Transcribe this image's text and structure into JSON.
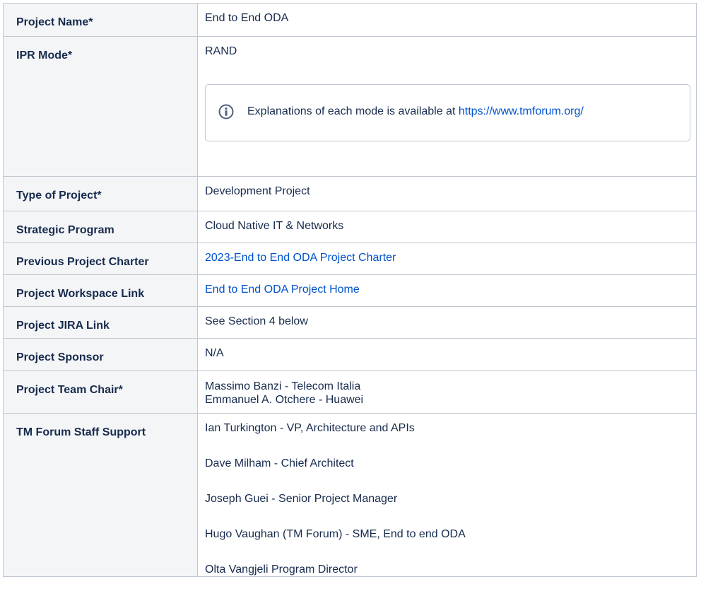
{
  "rows": {
    "project_name": {
      "label": "Project Name*",
      "value": "End to End ODA"
    },
    "ipr_mode": {
      "label": "IPR Mode*",
      "value": "RAND",
      "info": {
        "icon": "info-icon",
        "text": "Explanations of each mode is available at ",
        "link": "https://www.tmforum.org/"
      }
    },
    "type_of_project": {
      "label": "Type of Project*",
      "value": "Development Project"
    },
    "strategic_program": {
      "label": "Strategic Program",
      "value": "Cloud Native IT & Networks"
    },
    "previous_charter": {
      "label": "Previous Project Charter",
      "link": "2023-End to End ODA Project Charter"
    },
    "workspace_link": {
      "label": "Project Workspace Link",
      "link": "End to End ODA Project Home"
    },
    "jira_link": {
      "label": "Project JIRA Link",
      "value": "See Section 4 below"
    },
    "sponsor": {
      "label": "Project Sponsor",
      "value": "N/A"
    },
    "team_chair": {
      "label": "Project Team Chair*",
      "values": [
        "Massimo Banzi - Telecom Italia",
        "Emmanuel A. Otchere - Huawei"
      ]
    },
    "staff_support": {
      "label": "TM Forum Staff Support",
      "values": [
        "Ian Turkington - VP, Architecture and APIs",
        "Dave Milham - Chief Architect",
        "Joseph Guei  - Senior Project Manager",
        "Hugo Vaughan (TM Forum) - SME, End to end ODA",
        "Olta Vangjeli Program Director"
      ]
    }
  },
  "colors": {
    "label_bg": "#f4f5f7",
    "border": "#c1c7d0",
    "text": "#172b4d",
    "link": "#0052cc"
  }
}
